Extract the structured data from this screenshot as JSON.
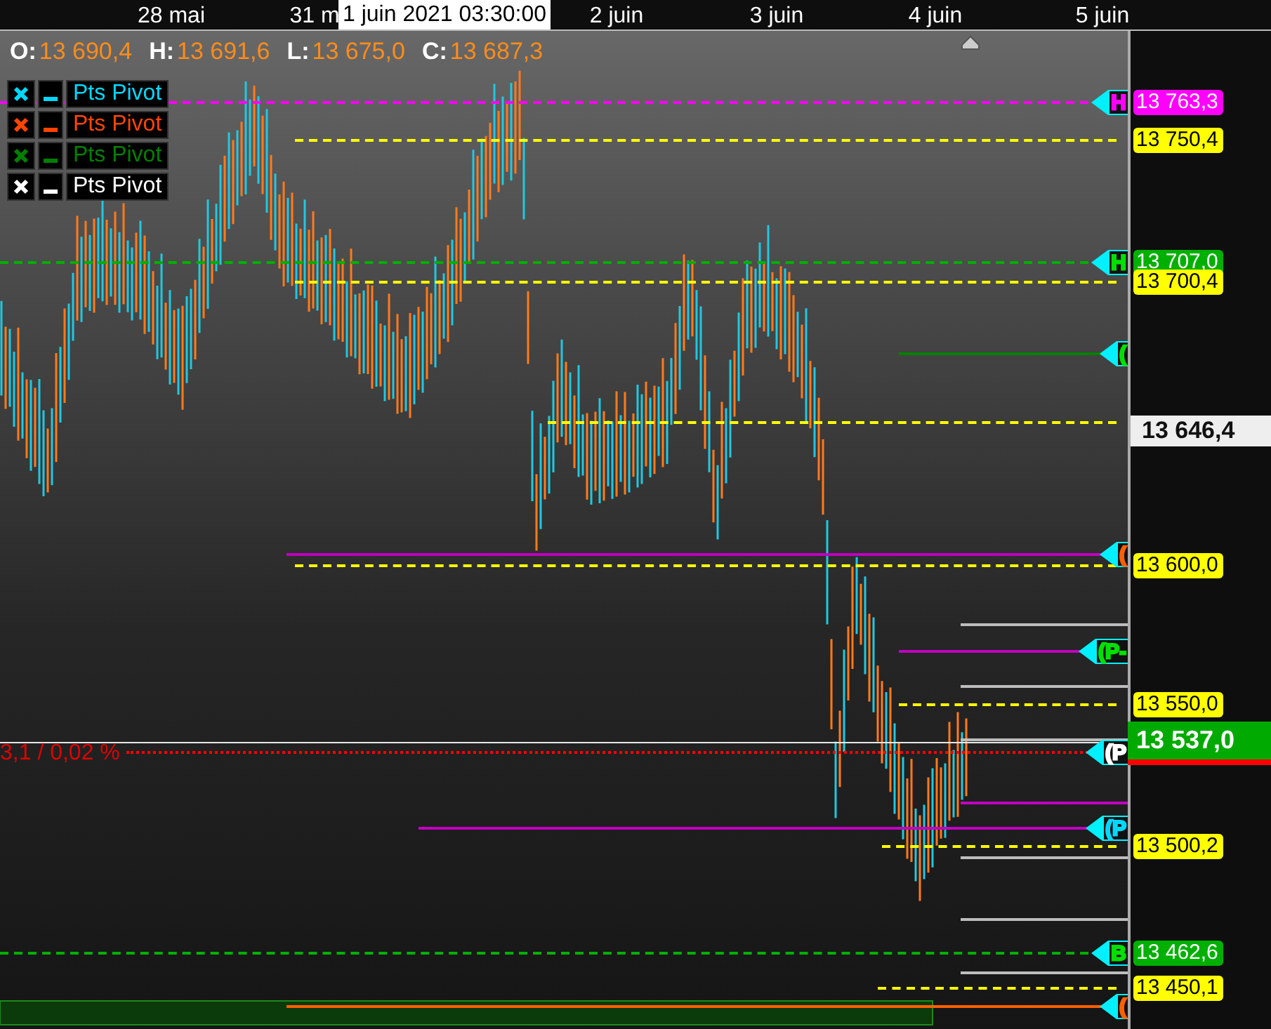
{
  "time_axis": {
    "dates": [
      "28 mai",
      "31 m",
      "2 juin",
      "3 juin",
      "4 juin",
      "5 juin"
    ],
    "cursor_time": "1 juin 2021 03:30:00"
  },
  "ohlc": [
    {
      "key": "O:",
      "value": "13 690,4"
    },
    {
      "key": "H:",
      "value": "13 691,6"
    },
    {
      "key": "L:",
      "value": "13 675,0"
    },
    {
      "key": "C:",
      "value": "13 687,3"
    }
  ],
  "legend": [
    {
      "label": "Pts Pivot",
      "color": "#00d8ff"
    },
    {
      "label": "Pts Pivot",
      "color": "#ff4500"
    },
    {
      "label": "Pts Pivot",
      "color": "#008000"
    },
    {
      "label": "Pts Pivot",
      "color": "#ffffff"
    }
  ],
  "levels": [
    {
      "kind": "dashed",
      "color": "#ff00ff",
      "label": "13 763,3",
      "marker": {
        "text": "H",
        "color": "#ff00ff"
      }
    },
    {
      "kind": "dashed",
      "color": "#ffff00",
      "label": "13 750,4"
    },
    {
      "kind": "dashed",
      "color": "#00b000",
      "label": "13 707,0",
      "marker": {
        "text": "H",
        "color": "#00e000"
      }
    },
    {
      "kind": "dashed",
      "color": "#ffff00",
      "label": "13 700,4"
    },
    {
      "kind": "solid",
      "color": "#008000",
      "marker": {
        "text": "(",
        "color": "#00e000"
      }
    },
    {
      "kind": "dashed",
      "color": "#ffff00"
    },
    {
      "kind": "solid",
      "color": "#c000c0",
      "marker": {
        "text": "(",
        "color": "#ff6000"
      }
    },
    {
      "kind": "dashed",
      "color": "#ffff00",
      "label": "13 600,0"
    },
    {
      "kind": "solid",
      "color": "#c000c0",
      "marker": {
        "text": "(P-",
        "color": "#00e000"
      }
    },
    {
      "kind": "dashed",
      "color": "#ffff00",
      "label": "13 550,0"
    },
    {
      "kind": "dotted",
      "color": "#ff0000",
      "marker": {
        "text": "(P",
        "color": "#ffffff"
      }
    },
    {
      "kind": "solid",
      "color": "#c000c0",
      "marker": {
        "text": "(P",
        "color": "#00d8ff"
      }
    },
    {
      "kind": "dashed",
      "color": "#ffff00",
      "label": "13 500,2"
    },
    {
      "kind": "dashed",
      "color": "#00b000",
      "label": "13 462,6",
      "marker": {
        "text": "B",
        "color": "#00e000"
      }
    },
    {
      "kind": "dashed",
      "color": "#ffff00",
      "label": "13 450,1"
    },
    {
      "kind": "solid",
      "color": "#ff6000",
      "marker": {
        "text": "(",
        "color": "#ff6000"
      }
    }
  ],
  "spread": "3,1 / 0,02 %",
  "current_price": "13 646,4",
  "last_price": "13 537,0"
}
